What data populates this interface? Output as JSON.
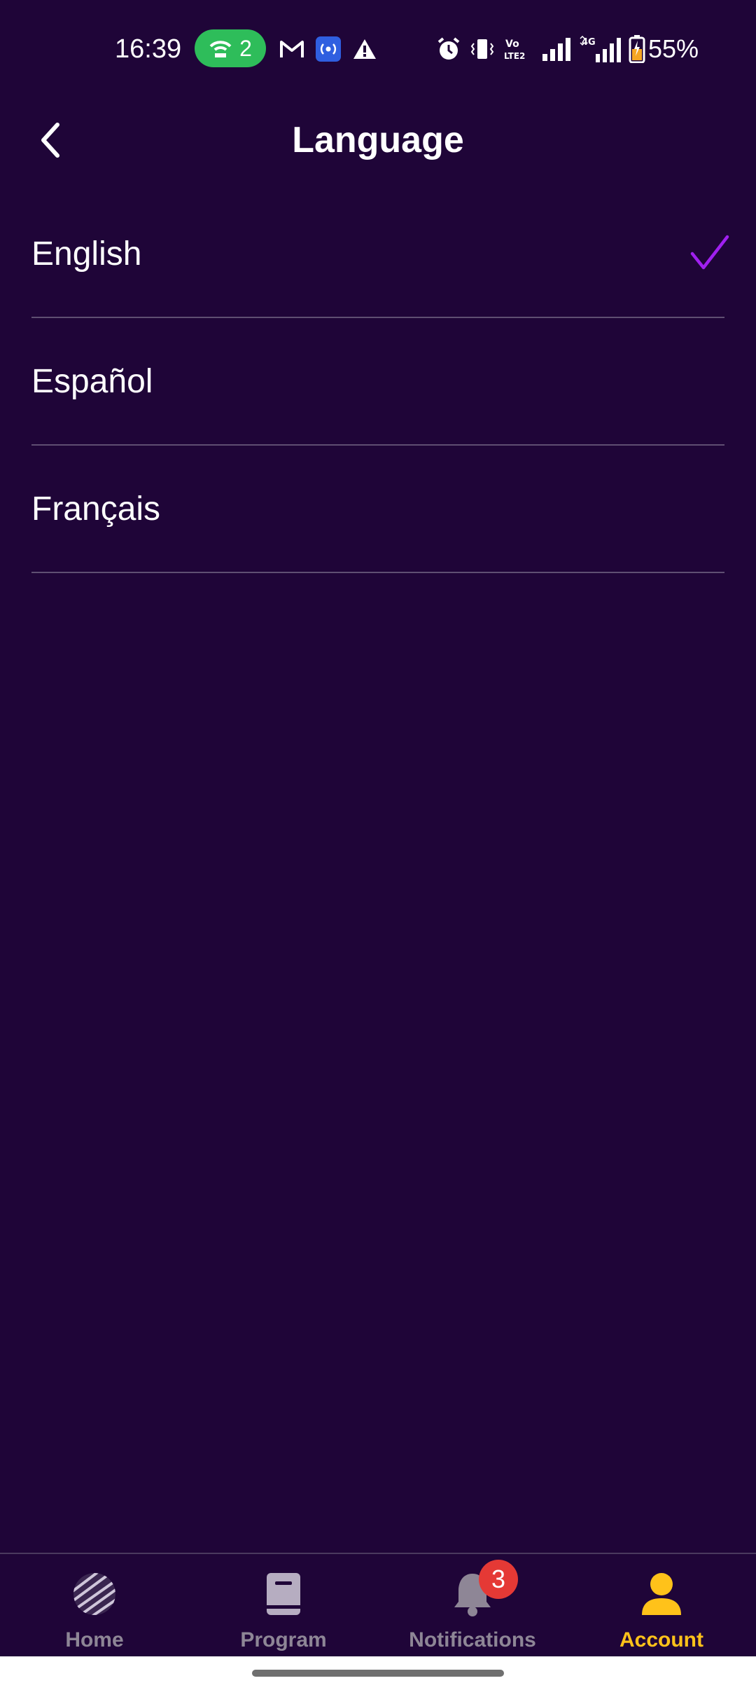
{
  "status_bar": {
    "time": "16:39",
    "hotspot_count": "2",
    "battery": "55%",
    "icons": [
      "hotspot-icon",
      "gmail-icon",
      "radio-icon",
      "warning-icon",
      "alarm-icon",
      "vibrate-icon",
      "volte-icon",
      "signal-icon",
      "signal-4g-icon",
      "battery-icon"
    ]
  },
  "header": {
    "title": "Language",
    "back_icon": "chevron-left-icon"
  },
  "languages": [
    {
      "label": "English",
      "selected": true
    },
    {
      "label": "Español",
      "selected": false
    },
    {
      "label": "Français",
      "selected": false
    }
  ],
  "bottom_nav": {
    "items": [
      {
        "label": "Home",
        "icon": "globe-icon",
        "active": false
      },
      {
        "label": "Program",
        "icon": "book-icon",
        "active": false
      },
      {
        "label": "Notifications",
        "icon": "bell-icon",
        "active": false,
        "badge": "3"
      },
      {
        "label": "Account",
        "icon": "person-icon",
        "active": true
      }
    ]
  },
  "colors": {
    "background": "#1f0538",
    "check": "#a020f0",
    "active_tab": "#ffc21a",
    "inactive_tab": "#8e8696",
    "badge": "#e53935"
  }
}
